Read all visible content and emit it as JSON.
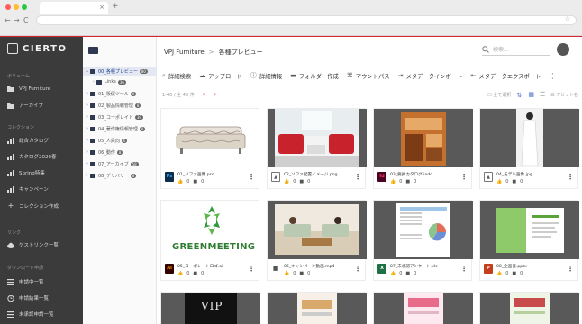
{
  "browser": {
    "tab_close": "×",
    "new_tab": "+",
    "back": "←",
    "forward": "→",
    "reload": "C",
    "bookmark": "☆"
  },
  "app": {
    "brand": "CIERTO"
  },
  "sidebar": {
    "section_volume": "ボリューム",
    "vol_items": [
      "VPJ Furniture",
      "アーカイブ"
    ],
    "section_collection": "コレクション",
    "col_items": [
      "総合カタログ",
      "カタログ2020春",
      "Spring特集",
      "キャンペーン",
      "コレクション作成"
    ],
    "section_link": "リンク",
    "link_items": [
      "ゲストリンク一覧"
    ],
    "section_download": "ダウンロード申請",
    "dl_items": [
      "申請中一覧",
      "申請結果一覧",
      "未承認申請一覧"
    ]
  },
  "tree": {
    "items": [
      {
        "label": "00_各種プレビュー",
        "badge": "80"
      },
      {
        "label": "Links",
        "badge": "36"
      },
      {
        "label": "01_販促ツール",
        "badge": "8"
      },
      {
        "label": "02_製品情報管理",
        "badge": "8"
      },
      {
        "label": "03_コーポレイト",
        "badge": "39"
      },
      {
        "label": "04_著作権情報管理",
        "badge": "8"
      },
      {
        "label": "05_人員向",
        "badge": "6"
      },
      {
        "label": "06_動作",
        "badge": "8"
      },
      {
        "label": "07_アーカイブ",
        "badge": "58"
      },
      {
        "label": "08_デリバリー",
        "badge": "8"
      }
    ]
  },
  "main": {
    "crumb_volume": "VPJ Furniture",
    "crumb_sep": ">",
    "crumb_current": "各種プレビュー",
    "search_placeholder": "検索...",
    "toolbar": [
      "詳細検索",
      "アップロード",
      "詳細情報",
      "フォルダー作成",
      "マウントパス",
      "メタデータインポート",
      "メタデータエクスポート"
    ],
    "count": "1-40 / 全 40 件",
    "pager_prev": "‹",
    "pager_next": "›",
    "select_all": "全て選択",
    "preset": "アセット名"
  },
  "cards": [
    {
      "name": "01_ソファ画像.psd",
      "type": "Ps",
      "color": "#0a2d4d",
      "likes": "0",
      "comments": "0"
    },
    {
      "name": "02_ソファ配置イメージ.png",
      "type": "img",
      "color": "#6b6b6b",
      "likes": "0",
      "comments": "0"
    },
    {
      "name": "03_要員カタログ.indd",
      "type": "Id",
      "color": "#49021f",
      "likes": "0",
      "comments": "0"
    },
    {
      "name": "04_モデル画像.jpg",
      "type": "img",
      "color": "#6b6b6b",
      "likes": "0",
      "comments": "0"
    },
    {
      "name": "05_コーポレートロゴ.ai",
      "type": "Ai",
      "color": "#330000",
      "likes": "0",
      "comments": "0"
    },
    {
      "name": "06_キャンペーン動画.mp4",
      "type": "vid",
      "color": "#6b6b6b",
      "likes": "0",
      "comments": "0"
    },
    {
      "name": "07_未承認アンケート.xls",
      "type": "X",
      "color": "#1e7145",
      "likes": "0",
      "comments": "0"
    },
    {
      "name": "08_企画書.pptx",
      "type": "P",
      "color": "#c43e1c",
      "likes": "0",
      "comments": "0"
    }
  ],
  "thumb_text": {
    "logo_word": "GREENMEETING",
    "vip": "VIP"
  },
  "stat_icons": {
    "like": "👍",
    "comment": "■"
  }
}
